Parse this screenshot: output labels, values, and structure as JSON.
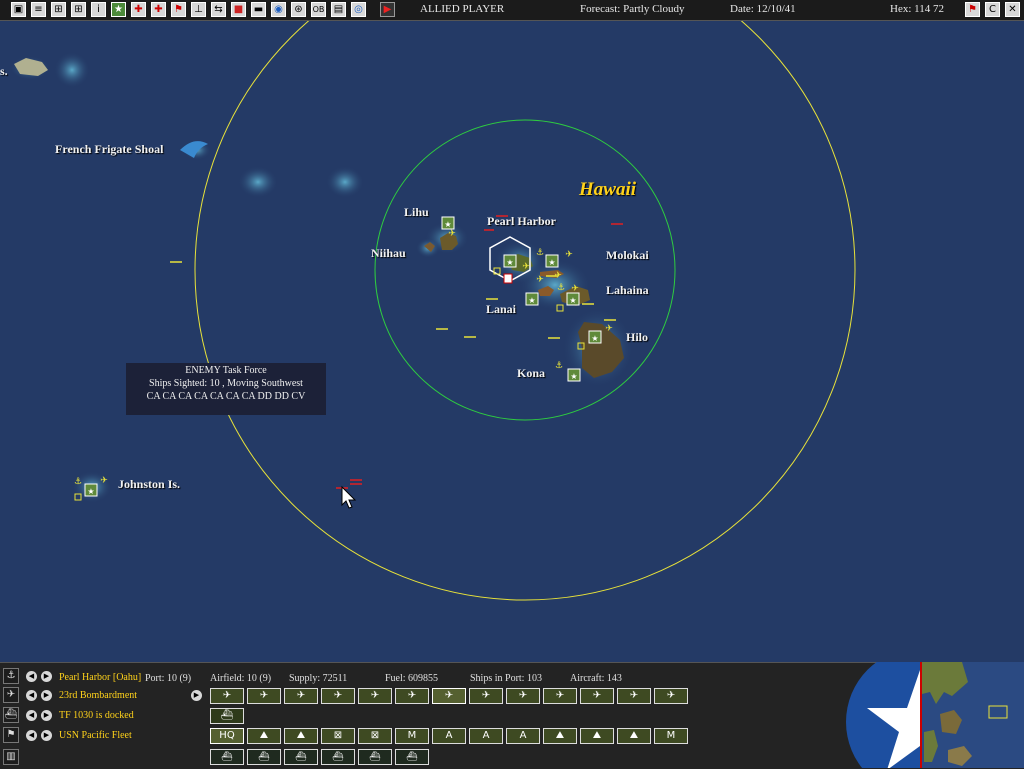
{
  "topbar": {
    "icons": [
      "▣",
      "≡",
      "⊞",
      "⊞",
      "i",
      "★",
      "✚",
      "✚",
      "⚑",
      "⊥",
      "⇆",
      "■",
      "▬",
      "◉",
      "⊛",
      "OB",
      "▤",
      "◎",
      "▶"
    ],
    "player": "ALLIED PLAYER",
    "forecast": "Forecast: Partly Cloudy",
    "date": "Date: 12/10/41",
    "hex": "Hex: 114  72",
    "right_icons": [
      "⚑",
      "C",
      "✕"
    ]
  },
  "map": {
    "region_title": "Hawaii",
    "labels": {
      "edge": "s.",
      "french_frigate": "French Frigate Shoal",
      "lihu": "Lihu",
      "pearl_harbor": "Pearl Harbor",
      "niihau": "Niihau",
      "molokai": "Molokai",
      "lahaina": "Lahaina",
      "lanai": "Lanai",
      "hilo": "Hilo",
      "kona": "Kona",
      "johnston": "Johnston Is."
    },
    "tooltip": {
      "line1": "ENEMY Task Force",
      "line2": "Ships Sighted: 10 , Moving Southwest",
      "line3": "CA CA CA CA CA CA CA DD DD CV"
    },
    "colors": {
      "ocean": "#243a66",
      "outer_range": "#e8e23a",
      "inner_range": "#2ecc40",
      "enemy": "#e02020"
    }
  },
  "bottom": {
    "base": "Pearl Harbor [Oahu]",
    "unit": "23rd Bombardment",
    "tf": "TF 1030 is docked",
    "fleet": "USN Pacific Fleet",
    "stats": {
      "port": "Port: 10 (9)",
      "airfield": "Airfield: 10 (9)",
      "supply": "Supply: 72511",
      "fuel": "Fuel: 609855",
      "ships": "Ships in Port: 103",
      "aircraft": "Aircraft: 143"
    },
    "row2_buttons": [
      "HQ",
      "⛰",
      "⛰",
      "⊠",
      "⊠",
      "M",
      "A",
      "A",
      "A",
      "⛰",
      "⛰",
      "⛰",
      "M"
    ],
    "row3_buttons": [
      "⛴",
      "⛴",
      "⛴",
      "⛴",
      "⛴",
      "⛴"
    ]
  }
}
